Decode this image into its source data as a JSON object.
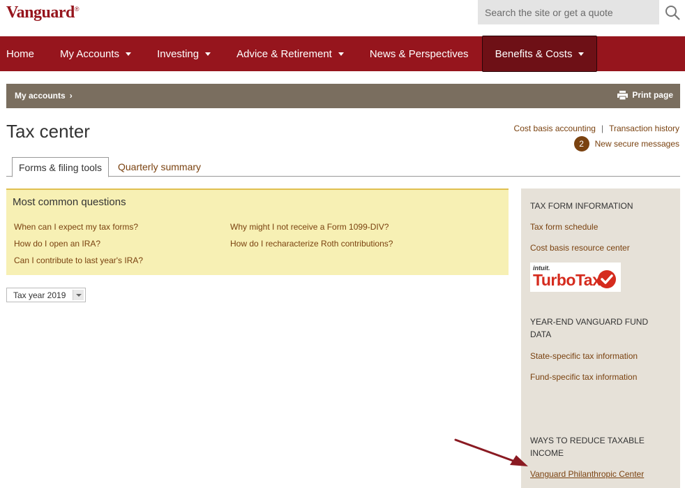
{
  "header": {
    "logo": "Vanguard",
    "logo_mark": "®",
    "search_placeholder": "Search the site or get a quote"
  },
  "nav": {
    "items": [
      {
        "label": "Home",
        "dropdown": false
      },
      {
        "label": "My Accounts",
        "dropdown": true
      },
      {
        "label": "Investing",
        "dropdown": true
      },
      {
        "label": "Advice & Retirement",
        "dropdown": true
      },
      {
        "label": "News & Perspectives",
        "dropdown": false
      },
      {
        "label": "Benefits & Costs",
        "dropdown": true,
        "active": true
      }
    ]
  },
  "breadcrumb": {
    "label": "My accounts",
    "print_label": "Print page"
  },
  "page": {
    "title": "Tax center",
    "links": {
      "cost_basis": "Cost basis accounting",
      "separator": "|",
      "transactions": "Transaction history"
    },
    "messages": {
      "count": "2",
      "label": "New secure messages"
    }
  },
  "tabs": [
    {
      "label": "Forms & filing tools",
      "active": true
    },
    {
      "label": "Quarterly summary",
      "active": false
    }
  ],
  "faq": {
    "title": "Most common questions",
    "questions": [
      "When can I expect my tax forms?",
      "How do I open an IRA?",
      "Can I contribute to last year's IRA?",
      "Why might I not receive a Form 1099-DIV?",
      "How do I recharacterize Roth contributions?"
    ]
  },
  "tax_year": {
    "selected": "Tax year 2019"
  },
  "sidebar": {
    "section1": {
      "heading": "TAX FORM INFORMATION",
      "links": [
        "Tax form schedule",
        "Cost basis resource center"
      ],
      "turbotax_brand": "intuit.",
      "turbotax_name": "TurboTax"
    },
    "section2": {
      "heading": "YEAR-END VANGUARD FUND DATA",
      "links": [
        "State-specific tax information",
        "Fund-specific tax information"
      ]
    },
    "section3": {
      "heading": "WAYS TO REDUCE TAXABLE INCOME",
      "links": [
        "Vanguard Philanthropic Center"
      ]
    }
  },
  "colors": {
    "brand": "#96151d",
    "link": "#7a4210",
    "crumb_bar": "#7a6e5f",
    "faq_bg": "#f7f0b4",
    "sidebar_bg": "#e6e1d8"
  }
}
